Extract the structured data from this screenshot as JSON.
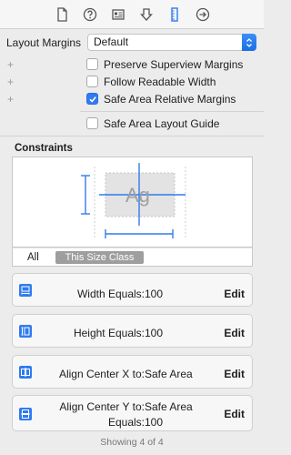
{
  "toolbar": {
    "icons": [
      "file-icon",
      "help-icon",
      "identity-icon",
      "attributes-icon",
      "size-icon",
      "connections-icon"
    ]
  },
  "layout_margins": {
    "label": "Layout Margins",
    "value": "Default"
  },
  "options": [
    {
      "label": "Preserve Superview Margins",
      "checked": false
    },
    {
      "label": "Follow Readable Width",
      "checked": false
    },
    {
      "label": "Safe Area Relative Margins",
      "checked": true
    }
  ],
  "safe_area_guide": {
    "label": "Safe Area Layout Guide",
    "checked": false
  },
  "constraints": {
    "title": "Constraints",
    "diagram_text": "Ag",
    "seg_all": "All",
    "seg_size_class": "This Size Class"
  },
  "cards": [
    {
      "name": "Width Equals:",
      "value": "100",
      "edit": "Edit"
    },
    {
      "name": "Height Equals:",
      "value": "100",
      "edit": "Edit"
    },
    {
      "name": "Align Center X to:",
      "value": "Safe Area",
      "edit": "Edit"
    },
    {
      "name": "Align Center Y to:",
      "value": "Safe Area",
      "name2": "Equals:",
      "value2": "100",
      "edit": "Edit"
    }
  ],
  "footer": "Showing 4 of 4",
  "colors": {
    "accent": "#2f7bf0",
    "constraint_blue": "#2f7bf0"
  }
}
